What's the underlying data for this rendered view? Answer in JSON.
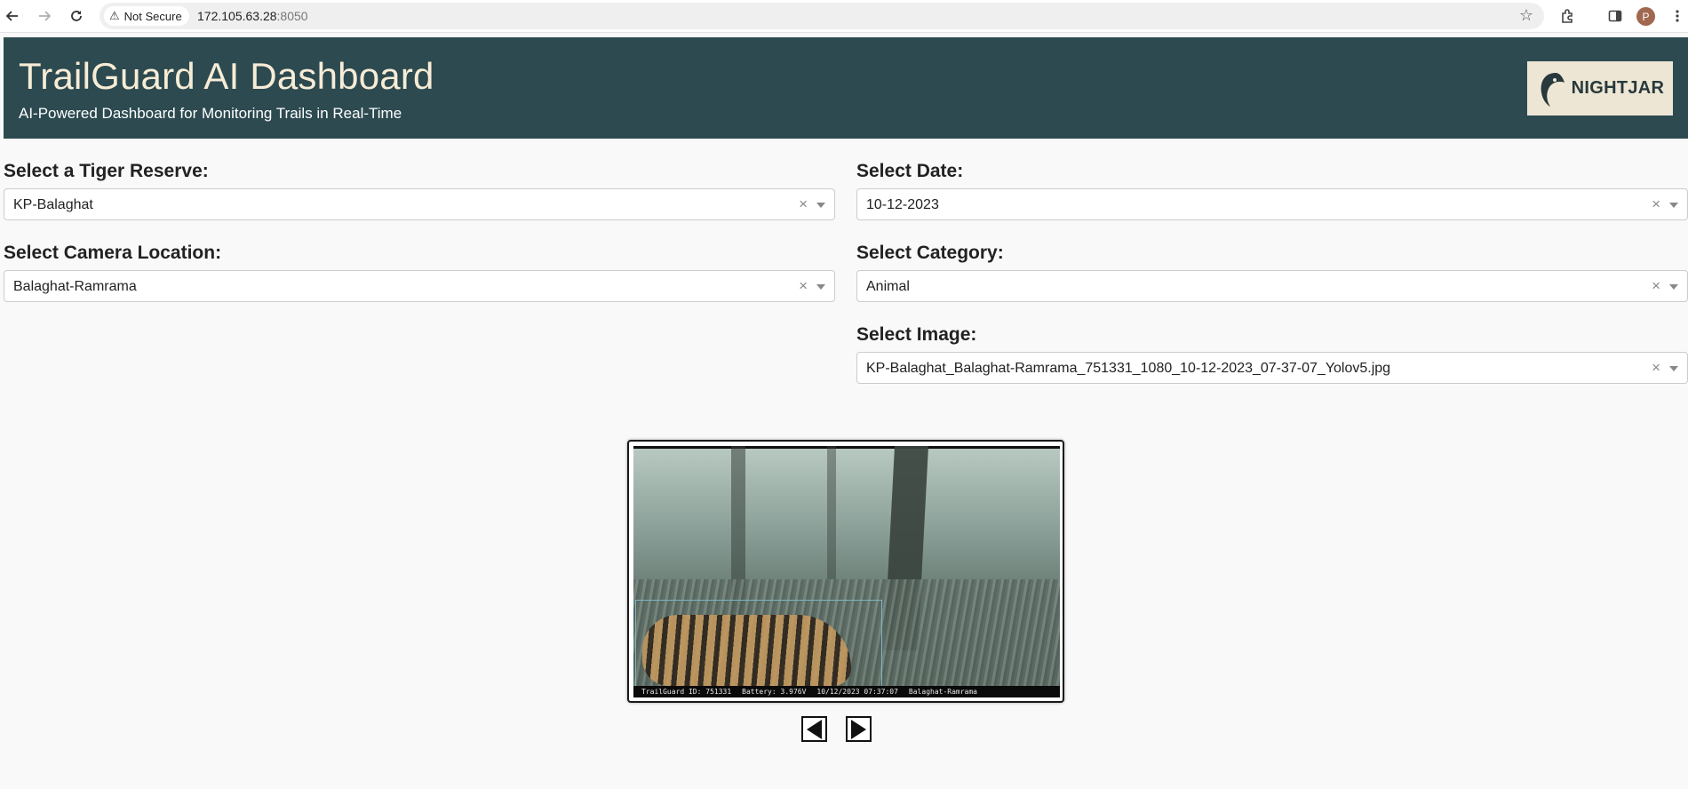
{
  "browser": {
    "security_label": "Not Secure",
    "url_host": "172.105.63.28",
    "url_port": ":8050",
    "profile_initial": "P"
  },
  "header": {
    "title": "TrailGuard AI Dashboard",
    "subtitle": "AI-Powered Dashboard for Monitoring Trails in Real-Time",
    "logo_text": "NIGHTJAR",
    "background_color": "#2c4a50",
    "title_color": "#f7ecd6"
  },
  "filters": {
    "reserve": {
      "label": "Select a Tiger Reserve:",
      "value": "KP-Balaghat"
    },
    "camera": {
      "label": "Select Camera Location:",
      "value": "Balaghat-Ramrama"
    },
    "date": {
      "label": "Select Date:",
      "value": "10-12-2023"
    },
    "category": {
      "label": "Select Category:",
      "value": "Animal"
    },
    "image": {
      "label": "Select Image:",
      "value": "KP-Balaghat_Balaghat-Ramrama_751331_1080_10-12-2023_07-37-07_Yolov5.jpg"
    }
  },
  "viewer": {
    "caption": {
      "trailguard_id": "TrailGuard ID: 751331",
      "battery": "Battery: 3.976V",
      "timestamp": "10/12/2023 07:37:07",
      "location": "Balaghat-Ramrama"
    },
    "prev_icon": "triangle-left-icon",
    "next_icon": "triangle-right-icon"
  },
  "icons": {
    "back": "arrow-left-icon",
    "forward": "arrow-right-icon",
    "reload": "reload-icon",
    "warning": "warning-icon",
    "bookmark": "star-icon",
    "extensions": "puzzle-icon",
    "sidebar": "sidebar-icon",
    "menu": "kebab-menu-icon",
    "clear": "clear-icon",
    "dropdown": "chevron-down-icon"
  }
}
